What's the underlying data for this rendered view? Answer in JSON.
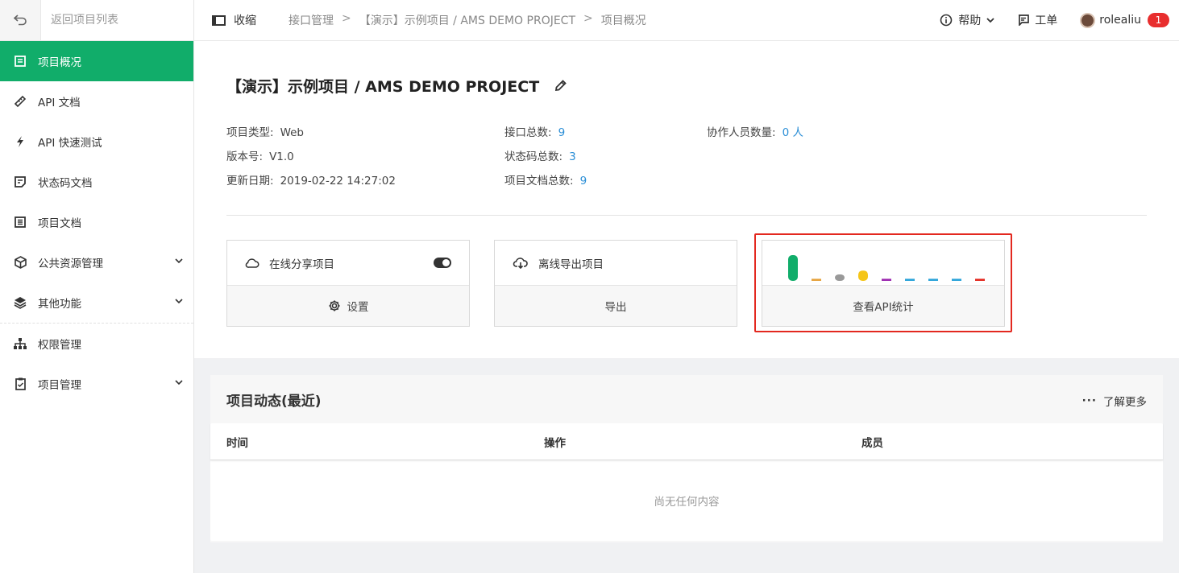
{
  "sidebar": {
    "back_label": "返回项目列表",
    "items": [
      {
        "label": "项目概况",
        "icon": "overview-icon",
        "active": true
      },
      {
        "label": "API 文档",
        "icon": "ruler-icon"
      },
      {
        "label": "API 快速测试",
        "icon": "lightning-icon"
      },
      {
        "label": "状态码文档",
        "icon": "note-icon"
      },
      {
        "label": "项目文档",
        "icon": "document-icon"
      },
      {
        "label": "公共资源管理",
        "icon": "cube-icon",
        "expandable": true
      },
      {
        "label": "其他功能",
        "icon": "layers-icon",
        "expandable": true
      },
      {
        "label": "权限管理",
        "icon": "hierarchy-icon"
      },
      {
        "label": "项目管理",
        "icon": "clipboard-icon",
        "expandable": true
      }
    ]
  },
  "topbar": {
    "collapse_label": "收缩",
    "breadcrumb": [
      "接口管理",
      "【演示】示例项目 / AMS DEMO PROJECT",
      "项目概况"
    ],
    "help_label": "帮助",
    "ticket_label": "工单",
    "username": "rolealiu",
    "notification_count": "1"
  },
  "project": {
    "title": "【演示】示例项目 / AMS DEMO PROJECT",
    "type_label": "项目类型:",
    "type_value": "Web",
    "version_label": "版本号:",
    "version_value": "V1.0",
    "updated_label": "更新日期:",
    "updated_value": "2019-02-22 14:27:02",
    "api_total_label": "接口总数:",
    "api_total_value": "9",
    "status_total_label": "状态码总数:",
    "status_total_value": "3",
    "doc_total_label": "项目文档总数:",
    "doc_total_value": "9",
    "members_label": "协作人员数量:",
    "members_value": "0 人"
  },
  "cards": {
    "share_label": "在线分享项目",
    "share_enabled": true,
    "settings_label": "设置",
    "export_head_label": "离线导出项目",
    "export_label": "导出",
    "stats_label": "查看API统计",
    "stats_colors": [
      "#11ad6a",
      "#e6a23c",
      "#999999",
      "#f5c518",
      "#9b27af",
      "#2aa3d9",
      "#2aa3d9",
      "#2aa3d9",
      "#e3281f"
    ],
    "stats_values": [
      1.0,
      0.08,
      0.25,
      0.4,
      0.08,
      0.08,
      0.08,
      0.08,
      0.08
    ]
  },
  "activity": {
    "title": "项目动态(最近)",
    "more_label": "了解更多",
    "columns": [
      "时间",
      "操作",
      "成员"
    ],
    "empty_text": "尚无任何内容"
  },
  "colors": {
    "accent": "#11ad6a",
    "link": "#2a8ed6",
    "highlight": "#e3281f",
    "badge": "#e82e2e"
  }
}
